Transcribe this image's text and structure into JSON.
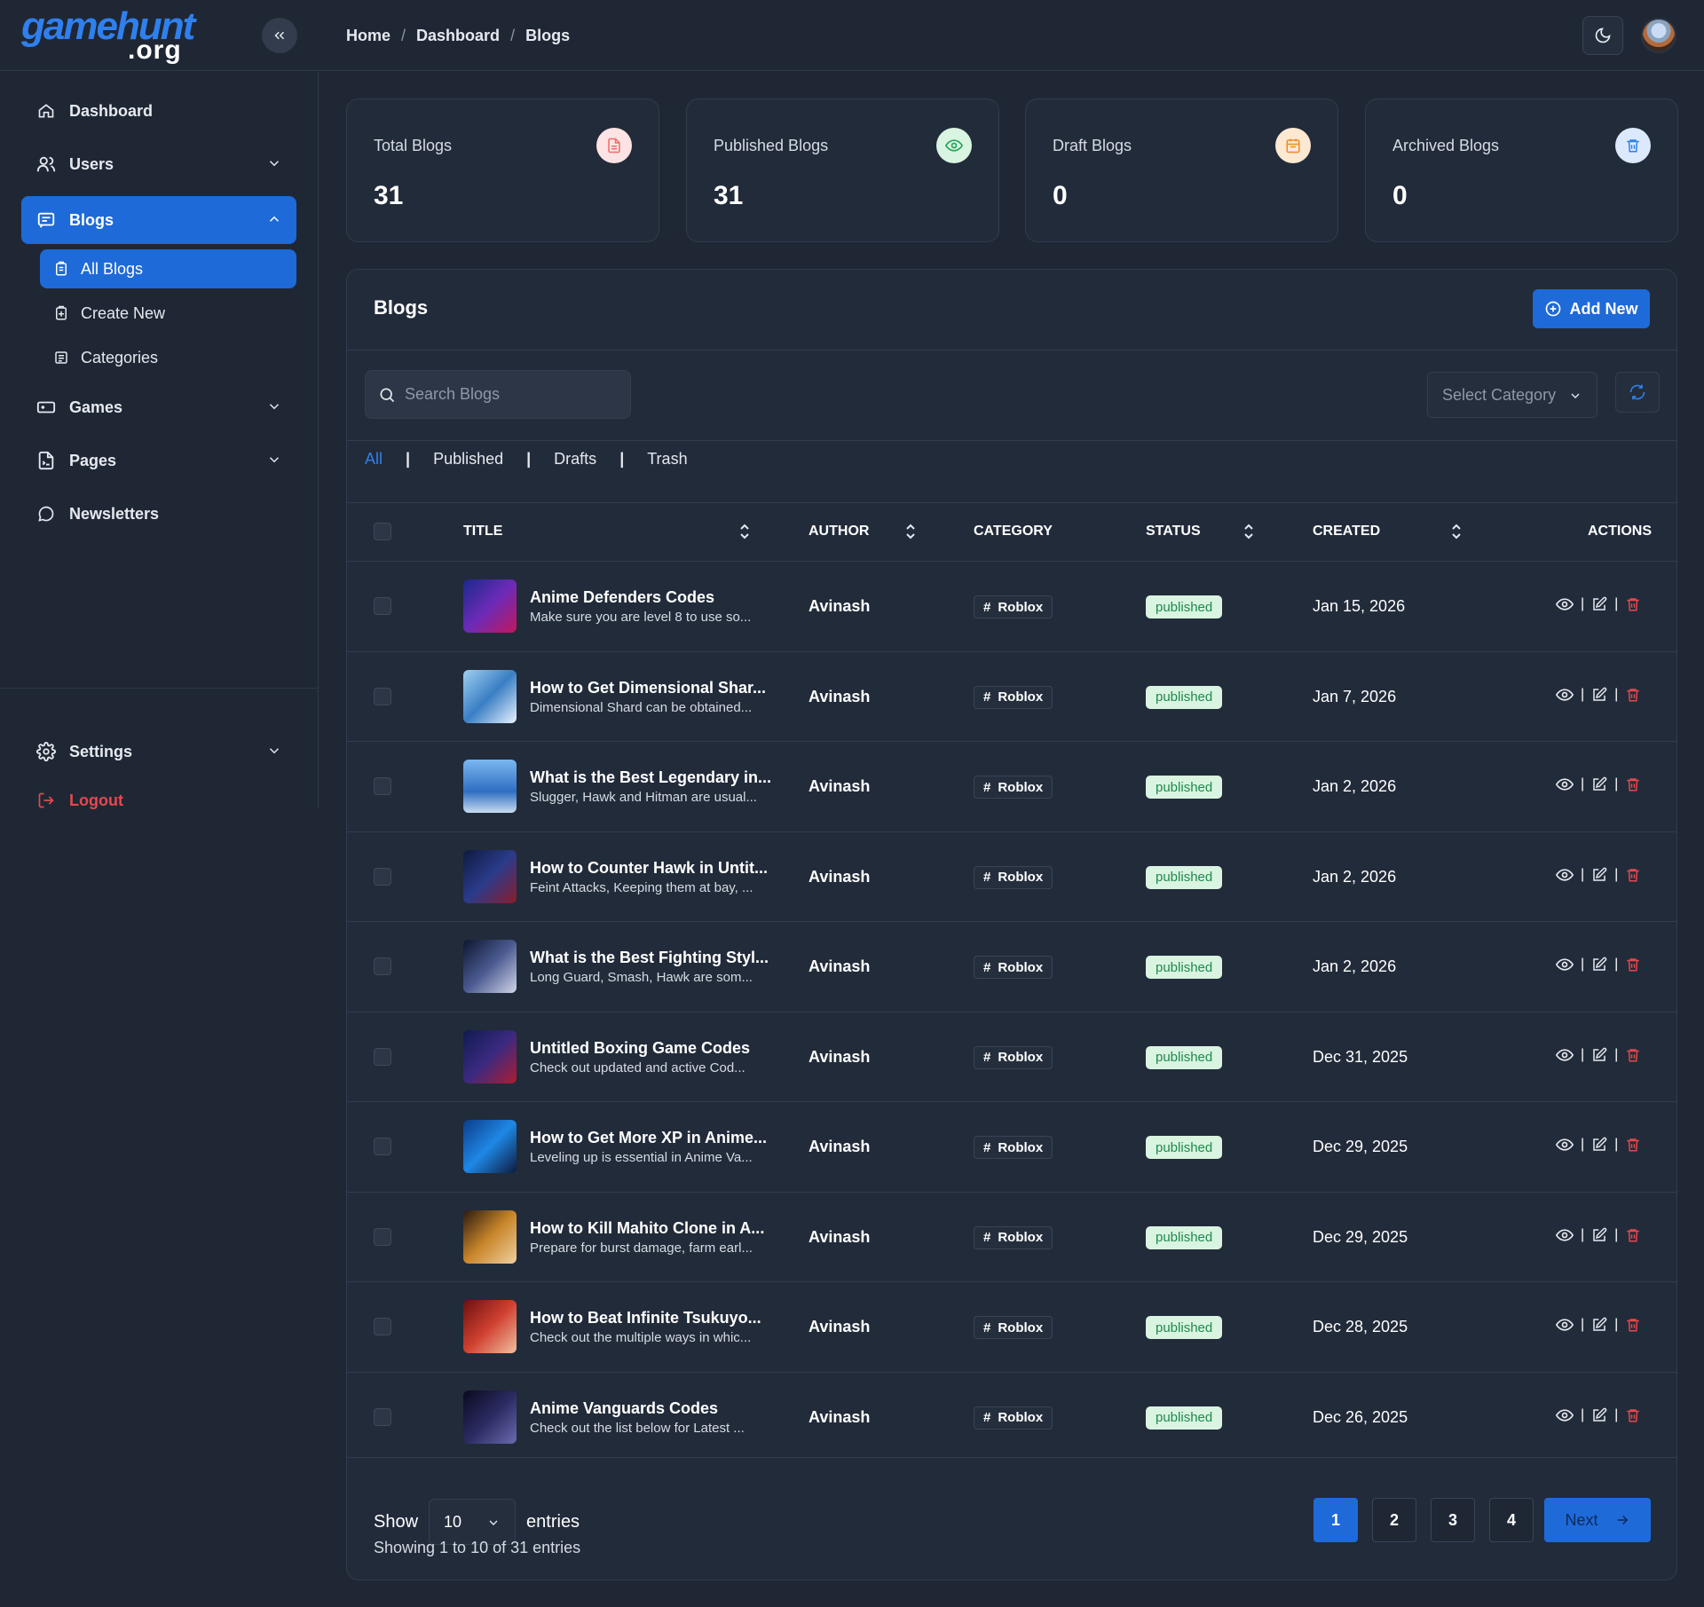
{
  "brand": {
    "logo_main": "gamehunt",
    "logo_sub": ".org"
  },
  "breadcrumb": [
    "Home",
    "Dashboard",
    "Blogs"
  ],
  "sidebar": {
    "items": [
      {
        "label": "Dashboard",
        "icon": "home-icon"
      },
      {
        "label": "Users",
        "icon": "users-icon"
      },
      {
        "label": "Blogs",
        "icon": "blog-icon"
      },
      {
        "label": "Games",
        "icon": "gamepad-icon"
      },
      {
        "label": "Pages",
        "icon": "page-icon"
      },
      {
        "label": "Newsletters",
        "icon": "chat-icon"
      }
    ],
    "blog_subitems": [
      {
        "label": "All Blogs",
        "icon": "clipboard-icon"
      },
      {
        "label": "Create New",
        "icon": "clipboard-plus-icon"
      },
      {
        "label": "Categories",
        "icon": "list-icon"
      }
    ],
    "settings_label": "Settings",
    "logout_label": "Logout"
  },
  "stats": [
    {
      "label": "Total Blogs",
      "value": "31",
      "icon": "document-icon",
      "color": "#f26b6b"
    },
    {
      "label": "Published Blogs",
      "value": "31",
      "icon": "eye-icon",
      "color": "#27a35a"
    },
    {
      "label": "Draft Blogs",
      "value": "0",
      "icon": "calendar-icon",
      "color": "#f08a24"
    },
    {
      "label": "Archived Blogs",
      "value": "0",
      "icon": "trash-icon",
      "color": "#2f80ed"
    }
  ],
  "panel": {
    "title": "Blogs",
    "add_label": "Add New",
    "search_placeholder": "Search Blogs",
    "category_placeholder": "Select Category",
    "tabs": [
      "All",
      "Published",
      "Drafts",
      "Trash"
    ],
    "columns": {
      "title": "TITLE",
      "author": "AUTHOR",
      "category": "CATEGORY",
      "status": "STATUS",
      "created": "CREATED",
      "actions": "ACTIONS"
    }
  },
  "rows": [
    {
      "title": "Anime Defenders Codes",
      "excerpt": "Make sure you are level 8 to use so...",
      "author": "Avinash",
      "category": "Roblox",
      "status": "published",
      "created": "Jan 15, 2026"
    },
    {
      "title": "How to Get Dimensional Shar...",
      "excerpt": "Dimensional Shard can be obtained...",
      "author": "Avinash",
      "category": "Roblox",
      "status": "published",
      "created": "Jan 7, 2026"
    },
    {
      "title": "What is the Best Legendary in...",
      "excerpt": "Slugger, Hawk and Hitman are usual...",
      "author": "Avinash",
      "category": "Roblox",
      "status": "published",
      "created": "Jan 2, 2026"
    },
    {
      "title": "How to Counter Hawk in Untit...",
      "excerpt": "Feint Attacks, Keeping them at bay, ...",
      "author": "Avinash",
      "category": "Roblox",
      "status": "published",
      "created": "Jan 2, 2026"
    },
    {
      "title": "What is the Best Fighting Styl...",
      "excerpt": "Long Guard, Smash, Hawk are som...",
      "author": "Avinash",
      "category": "Roblox",
      "status": "published",
      "created": "Jan 2, 2026"
    },
    {
      "title": "Untitled Boxing Game Codes",
      "excerpt": "Check out updated and active Cod...",
      "author": "Avinash",
      "category": "Roblox",
      "status": "published",
      "created": "Dec 31, 2025"
    },
    {
      "title": "How to Get More XP in Anime...",
      "excerpt": "Leveling up is essential in Anime Va...",
      "author": "Avinash",
      "category": "Roblox",
      "status": "published",
      "created": "Dec 29, 2025"
    },
    {
      "title": "How to Kill Mahito Clone in A...",
      "excerpt": "Prepare for burst damage, farm earl...",
      "author": "Avinash",
      "category": "Roblox",
      "status": "published",
      "created": "Dec 29, 2025"
    },
    {
      "title": "How to Beat Infinite Tsukuyo...",
      "excerpt": "Check out the multiple ways in whic...",
      "author": "Avinash",
      "category": "Roblox",
      "status": "published",
      "created": "Dec 28, 2025"
    },
    {
      "title": "Anime Vanguards Codes",
      "excerpt": "Check out the list below for Latest ...",
      "author": "Avinash",
      "category": "Roblox",
      "status": "published",
      "created": "Dec 26, 2025"
    }
  ],
  "footer": {
    "show_label": "Show",
    "page_size": "10",
    "entries_label": "entries",
    "showing_text": "Showing 1 to 10 of 31 entries",
    "pages": [
      "1",
      "2",
      "3",
      "4"
    ],
    "next_label": "Next"
  }
}
